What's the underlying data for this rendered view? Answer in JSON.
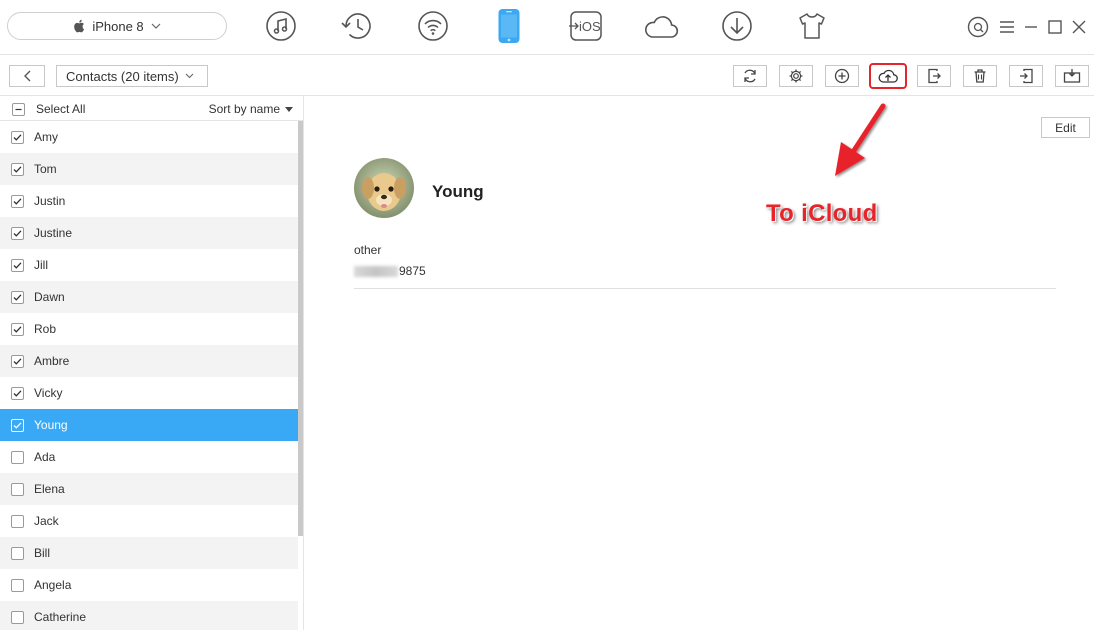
{
  "device": {
    "name": "iPhone 8"
  },
  "nav_icons": [
    "music-icon",
    "history-icon",
    "wifi-icon",
    "phone-icon",
    "to-ios-icon",
    "cloud-icon",
    "download-icon",
    "tshirt-icon"
  ],
  "nav_to_ios_label": "iOS",
  "toolbar": {
    "category_label": "Contacts (20 items)",
    "tools": [
      "refresh-icon",
      "settings-icon",
      "add-icon",
      "upload-cloud-icon",
      "export-icon",
      "delete-icon",
      "import-icon",
      "to-device-icon"
    ]
  },
  "list": {
    "select_all_label": "Select All",
    "sort_label": "Sort by name",
    "contacts": [
      {
        "name": "Amy",
        "checked": true
      },
      {
        "name": "Tom",
        "checked": true
      },
      {
        "name": "Justin",
        "checked": true
      },
      {
        "name": "Justine",
        "checked": true
      },
      {
        "name": "Jill",
        "checked": true
      },
      {
        "name": "Dawn",
        "checked": true
      },
      {
        "name": "Rob",
        "checked": true
      },
      {
        "name": "Ambre",
        "checked": true
      },
      {
        "name": "Vicky",
        "checked": true
      },
      {
        "name": "Young",
        "checked": true,
        "selected": true
      },
      {
        "name": "Ada",
        "checked": false
      },
      {
        "name": "Elena",
        "checked": false
      },
      {
        "name": "Jack",
        "checked": false
      },
      {
        "name": "Bill",
        "checked": false
      },
      {
        "name": "Angela",
        "checked": false
      },
      {
        "name": "Catherine",
        "checked": false
      }
    ]
  },
  "detail": {
    "edit_label": "Edit",
    "name": "Young",
    "phone_label": "other",
    "phone_visible_suffix": "9875"
  },
  "annotation": {
    "text": "To iCloud",
    "color": "#e8242a"
  },
  "colors": {
    "selected_row": "#39a9f5",
    "accent_phone": "#3aa8f2",
    "highlight_border": "#e4262c"
  }
}
